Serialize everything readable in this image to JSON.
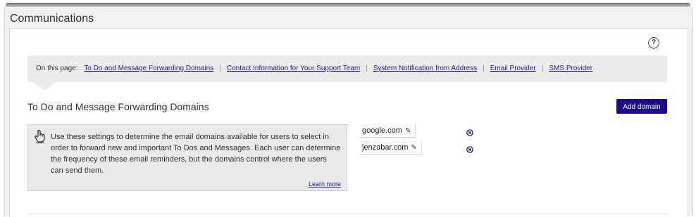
{
  "panel": {
    "title": "Communications"
  },
  "help": {
    "label": "?"
  },
  "on_page": {
    "label": "On this page:",
    "links": [
      "To Do and Message Forwarding Domains",
      "Contact Information for Your Support Team",
      "System Notification from Address",
      "Email Provider",
      "SMS Provider"
    ],
    "separator": "|"
  },
  "section": {
    "title": "To Do and Message Forwarding Domains",
    "add_button": "Add domain",
    "info_text": "Use these settings to determine the email domains available for users to select in order to forward new and important To Dos and Messages. Each user can determine the frequency of these email reminders, but the domains control where the users can send them.",
    "learn_more": "Learn more",
    "domains": [
      "google.com",
      "jenzabar.com"
    ]
  },
  "icons": [
    "help-icon",
    "pointer-hand-icon",
    "pencil-icon",
    "remove-circle-icon"
  ],
  "colors": {
    "accent_button": "#1c0a8a",
    "link": "#1a1aa6",
    "panel_bg": "#f1f1f1"
  }
}
